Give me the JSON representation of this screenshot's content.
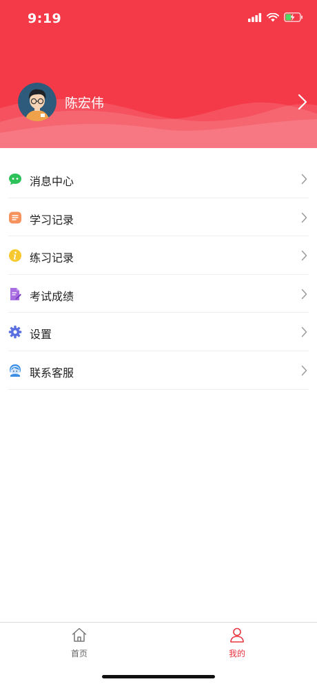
{
  "status_bar": {
    "time": "9:19"
  },
  "profile": {
    "username": "陈宏伟"
  },
  "menu": [
    {
      "label": "消息中心",
      "icon": "message-icon",
      "color": "#2dc259"
    },
    {
      "label": "学习记录",
      "icon": "study-record-icon",
      "color": "#f5925e"
    },
    {
      "label": "练习记录",
      "icon": "practice-record-icon",
      "color": "#f7c92e"
    },
    {
      "label": "考试成绩",
      "icon": "exam-score-icon",
      "color": "#a86de0"
    },
    {
      "label": "设置",
      "icon": "settings-gear-icon",
      "color": "#5a6fe0"
    },
    {
      "label": "联系客服",
      "icon": "customer-service-icon",
      "color": "#3a8ee6"
    }
  ],
  "tabbar": {
    "home_label": "首页",
    "mine_label": "我的",
    "active_color": "#e8333f"
  },
  "colors": {
    "header": "#f43a48"
  }
}
